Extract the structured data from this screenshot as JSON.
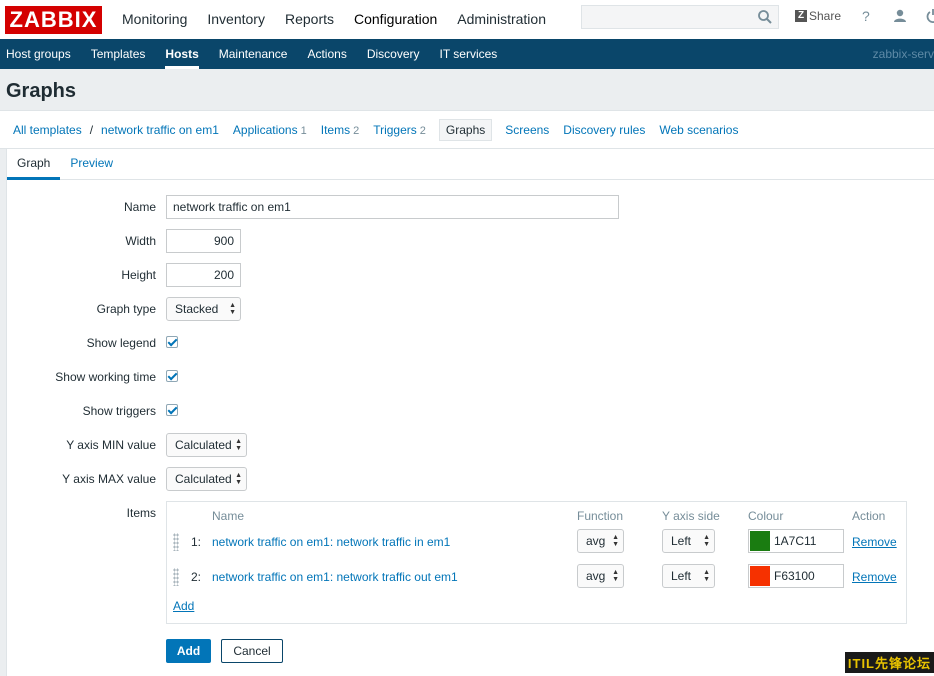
{
  "header": {
    "logo": "ZABBIX",
    "menu": [
      {
        "label": "Monitoring"
      },
      {
        "label": "Inventory"
      },
      {
        "label": "Reports"
      },
      {
        "label": "Configuration"
      },
      {
        "label": "Administration"
      }
    ],
    "share_label": "Share",
    "help_glyph": "?",
    "server": "zabbix-serv"
  },
  "subnav": [
    {
      "label": "Host groups"
    },
    {
      "label": "Templates"
    },
    {
      "label": "Hosts"
    },
    {
      "label": "Maintenance"
    },
    {
      "label": "Actions"
    },
    {
      "label": "Discovery"
    },
    {
      "label": "IT services"
    }
  ],
  "page_title": "Graphs",
  "breadcrumb": {
    "all_templates": "All templates",
    "separator": "/",
    "host": "network traffic on em1",
    "applications": {
      "label": "Applications",
      "count": "1"
    },
    "items": {
      "label": "Items",
      "count": "2"
    },
    "triggers": {
      "label": "Triggers",
      "count": "2"
    },
    "graphs": "Graphs",
    "screens": "Screens",
    "discovery_rules": "Discovery rules",
    "web_scenarios": "Web scenarios"
  },
  "tabs": {
    "graph": "Graph",
    "preview": "Preview"
  },
  "form": {
    "name": {
      "label": "Name",
      "value": "network traffic on em1"
    },
    "width": {
      "label": "Width",
      "value": "900"
    },
    "height": {
      "label": "Height",
      "value": "200"
    },
    "graph_type": {
      "label": "Graph type",
      "value": "Stacked"
    },
    "show_legend": {
      "label": "Show legend",
      "checked": true
    },
    "show_working_time": {
      "label": "Show working time",
      "checked": true
    },
    "show_triggers": {
      "label": "Show triggers",
      "checked": true
    },
    "y_min": {
      "label": "Y axis MIN value",
      "value": "Calculated"
    },
    "y_max": {
      "label": "Y axis MAX value",
      "value": "Calculated"
    },
    "items_label": "Items"
  },
  "items_table": {
    "headers": {
      "name": "Name",
      "function": "Function",
      "yaxis": "Y axis side",
      "colour": "Colour",
      "action": "Action"
    },
    "rows": [
      {
        "num": "1:",
        "name": "network traffic on em1: network traffic in em1",
        "function": "avg",
        "yaxis": "Left",
        "colour": "1A7C11",
        "remove": "Remove"
      },
      {
        "num": "2:",
        "name": "network traffic on em1: network traffic out em1",
        "function": "avg",
        "yaxis": "Left",
        "colour": "F63100",
        "remove": "Remove"
      }
    ],
    "add_link": "Add"
  },
  "buttons": {
    "add": "Add",
    "cancel": "Cancel"
  },
  "watermark": "ITIL先锋论坛"
}
